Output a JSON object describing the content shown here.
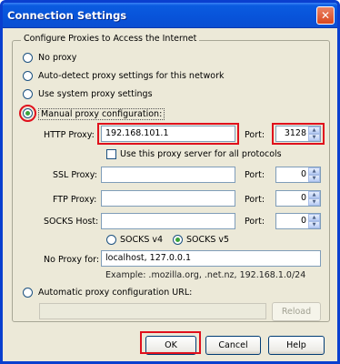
{
  "window": {
    "title": "Connection Settings",
    "close_glyph": "✕"
  },
  "group": {
    "legend": "Configure Proxies to Access the Internet",
    "options": {
      "no_proxy": "No proxy",
      "auto_detect": "Auto-detect proxy settings for this network",
      "system": "Use system proxy settings",
      "manual": "Manual proxy configuration:",
      "auto_url": "Automatic proxy configuration URL:"
    },
    "selected": "manual"
  },
  "manual": {
    "http_label": "HTTP Proxy:",
    "http_value": "192.168.101.1",
    "port_label": "Port:",
    "http_port": "3128",
    "same_proxy_label": "Use this proxy server for all protocols",
    "ssl_label": "SSL Proxy:",
    "ssl_value": "",
    "ssl_port": "0",
    "ftp_label": "FTP Proxy:",
    "ftp_value": "",
    "ftp_port": "0",
    "socks_label": "SOCKS Host:",
    "socks_value": "",
    "socks_port": "0",
    "socks_v4": "SOCKS v4",
    "socks_v5": "SOCKS v5",
    "no_proxy_label": "No Proxy for:",
    "no_proxy_value": "localhost, 127.0.0.1",
    "example": "Example: .mozilla.org, .net.nz, 192.168.1.0/24"
  },
  "auto": {
    "url_value": "",
    "reload_label": "Reload"
  },
  "buttons": {
    "ok": "OK",
    "cancel": "Cancel",
    "help": "Help"
  },
  "colors": {
    "title_bar": "#0853d9",
    "highlight": "#e0101c",
    "face": "#ece9d8"
  }
}
